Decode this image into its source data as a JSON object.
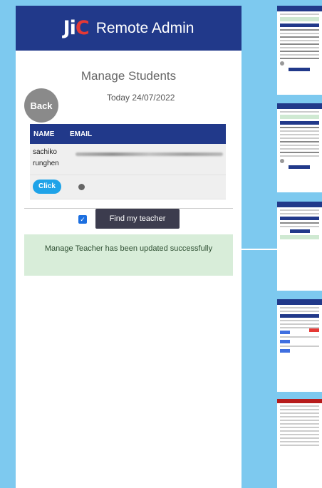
{
  "header": {
    "logo_text": "JiC",
    "title": "Remote Admin"
  },
  "page": {
    "title": "Manage Students",
    "back_label": "Back",
    "date": "Today 24/07/2022"
  },
  "table": {
    "columns": [
      "NAME",
      "EMAIL"
    ],
    "rows": [
      {
        "name_line1": "sachiko",
        "name_line2": "runghen"
      }
    ],
    "click_label": "Click"
  },
  "find_teacher": {
    "checked": true,
    "label": "Find my teacher"
  },
  "alert": {
    "text": "Manage Teacher has been updated successfully"
  },
  "colors": {
    "brand": "#21398a",
    "background": "#7dc9ef",
    "accent": "#1fa3e8",
    "alert_bg": "#d8edd9"
  }
}
